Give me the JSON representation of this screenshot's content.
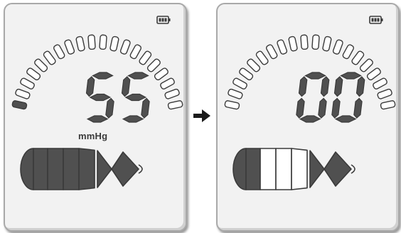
{
  "before": {
    "reading": "55",
    "unit": "mmHg",
    "battery_level": 1.0,
    "pressure_arc": {
      "total_segments": 20,
      "filled_segments": 1
    },
    "bulb_indicator": {
      "total_segments": 7,
      "filled_segments": 7
    }
  },
  "after": {
    "reading": "00",
    "unit": "",
    "battery_level": 1.0,
    "pressure_arc": {
      "total_segments": 20,
      "filled_segments": 0
    },
    "bulb_indicator": {
      "total_segments": 7,
      "filled_segments": 2
    }
  },
  "transition_arrow": "right-arrow-icon",
  "colors": {
    "panel_bg": "#f2f2f2",
    "panel_border": "#a9a9a9",
    "lcd_filled": "#505050",
    "lcd_outline": "#3a3a3a",
    "lcd_empty": "#ffffff"
  }
}
